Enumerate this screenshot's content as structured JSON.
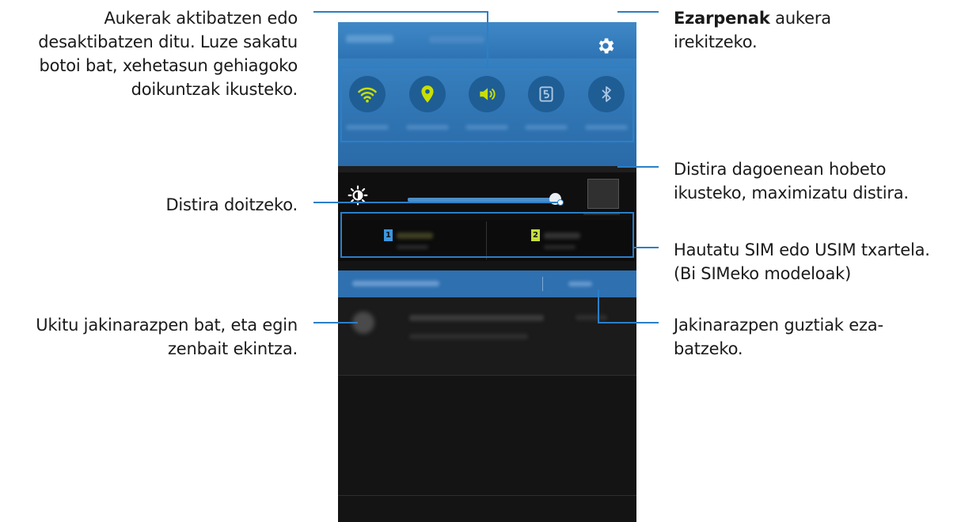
{
  "callouts": {
    "toggles_note": [
      "Aukerak aktibatzen edo",
      "desaktibatzen ditu. Luze sakatu",
      "botoi bat, xehetasun gehiagoko",
      "doikuntzak ikusteko."
    ],
    "brightness_note": "Distira doitzeko.",
    "notification_note": [
      "Ukitu jakinarazpen bat, eta egin",
      "zenbait ekintza."
    ],
    "settings_note_bold": "Ezarpenak",
    "settings_note_rest": " aukera",
    "settings_note_line2": "irekitzeko.",
    "outdoor_note": [
      "Distira dagoenean hobeto",
      "ikusteko, maximizatu distira."
    ],
    "sim_note": [
      "Hautatu SIM edo USIM txartela.",
      "(Bi SIMeko modeloak)"
    ],
    "clear_note": [
      "Jakinarazpen guztiak eza-",
      "batzeko."
    ]
  },
  "phone": {
    "quick_toggles": [
      {
        "icon": "wifi-icon",
        "active": true
      },
      {
        "icon": "location-icon",
        "active": true
      },
      {
        "icon": "sound-icon",
        "active": true
      },
      {
        "icon": "screen-rotation-icon",
        "active": false
      },
      {
        "icon": "bluetooth-icon",
        "active": false
      }
    ],
    "brightness_level": 0.97,
    "sim_badges": [
      "1",
      "2"
    ]
  },
  "colors": {
    "accent": "#2b7fc8",
    "toggle_active": "#c8e000",
    "panel_blue": "#3780bf"
  }
}
